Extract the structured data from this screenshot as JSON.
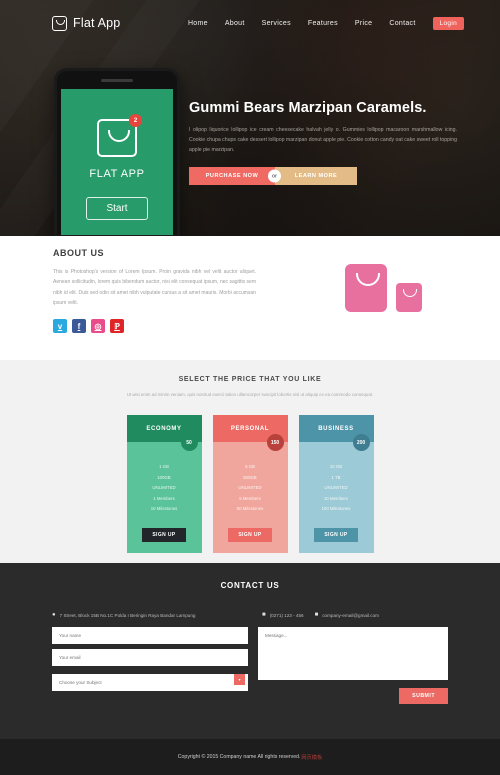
{
  "nav": {
    "logo_text": "Flat App",
    "links": [
      {
        "label": "Home"
      },
      {
        "label": "About"
      },
      {
        "label": "Services"
      },
      {
        "label": "Features"
      },
      {
        "label": "Price"
      },
      {
        "label": "Contact"
      },
      {
        "label": "Login"
      }
    ]
  },
  "hero": {
    "phone": {
      "app_name": "FLAT APP",
      "badge_count": "2",
      "start_label": "Start"
    },
    "title": "Gummi Bears Marzipan Caramels.",
    "paragraph": "I olipop liquorice lollipop ice cream cheesecake halvah jelly o. Gummies lollipop macaroon marshmallow icing. Cookie chupa chups cake dessert lollipop marzipan donut apple pie. Cookie cotton candy oat cake sweet roll topping apple pie marzipan.",
    "purchase_label": "PURCHASE NOW",
    "or_label": "or",
    "learn_label": "LEARN MORE",
    "accent_purchase": "#ef6a63",
    "accent_learn": "#e3bb86"
  },
  "about": {
    "heading": "ABOUT US",
    "paragraph": "This is Photoshop's version of Lorem Ipsum. Proin gravida nibh vel velit auctor aliquet. Aenean sollicitudin, lorem quis bibendum auctor, nisi elit consequat ipsum, nec sagittis sem nibh id elit. Duis sed odio sit amet nibh vulputate cursus a sit amet mauris. Morbi accumsan ipsum velit.",
    "socials": [
      {
        "name": "twitter",
        "glyph": "ᴠ",
        "color": "#29a9e0"
      },
      {
        "name": "facebook",
        "glyph": "f",
        "color": "#3b5998"
      },
      {
        "name": "dribbble",
        "glyph": "◎",
        "color": "#ea4c89"
      },
      {
        "name": "pinterest",
        "glyph": "ℙ",
        "color": "#e02529"
      }
    ]
  },
  "pricing": {
    "title": "SELECT THE PRICE THAT YOU LIKE",
    "subtitle": "Ut wisi enim ad minim veniam, quis nostrud exerci tation ullamcorper suscipit lobortis nisl ut aliquip ex ea commodo consequat.",
    "plans": [
      {
        "name": "ECONOMY",
        "price": "50",
        "features": [
          "1 GB",
          "100GB",
          "UNLIMITED",
          "1 Members",
          "10 Milestones"
        ],
        "cta": "SIGN UP",
        "color": "#5ac39a",
        "head_color": "#1f8b5f"
      },
      {
        "name": "PERSONAL",
        "price": "150",
        "features": [
          "5 GB",
          "500GB",
          "UNLIMITED",
          "5 Members",
          "50 Milestones"
        ],
        "cta": "SIGN UP",
        "color": "#f1a69d",
        "head_color": "#ec6a63"
      },
      {
        "name": "BUSINESS",
        "price": "200",
        "features": [
          "10 GB",
          "1 TB",
          "UNLIMITED",
          "10 Members",
          "100 Milestones"
        ],
        "cta": "SIGN UP",
        "color": "#9ccad6",
        "head_color": "#4e94a8"
      }
    ]
  },
  "contact": {
    "title": "CONTACT US",
    "address": "7 Street, Block 15B No.1C Polda I Beringin Raya Bandar Lampung",
    "phone": "(0271) 123 - 456",
    "email": "company-email@gmail.com",
    "form": {
      "name_placeholder": "Your name",
      "email_placeholder": "Your email",
      "subject_placeholder": "Choose your Subject",
      "message_placeholder": "Message...",
      "submit_label": "SUBMIT"
    }
  },
  "footer": {
    "copyright": "Copyright © 2015 Company name All rights reserved.",
    "extra": "网页模板"
  }
}
